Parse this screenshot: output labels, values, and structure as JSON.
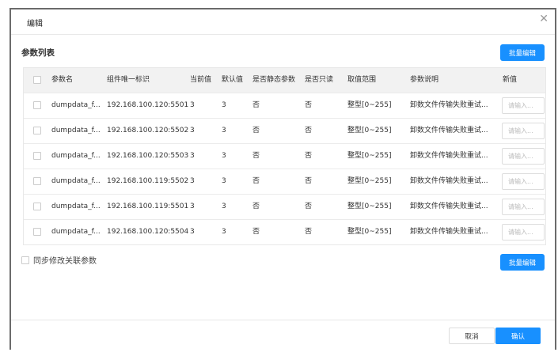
{
  "dialog": {
    "title": "编辑",
    "close_icon": "close-icon"
  },
  "section_title": "参数列表",
  "batch_edit_label": "批量编辑",
  "table": {
    "headers": [
      "参数名",
      "组件唯一标识",
      "当前值",
      "默认值",
      "是否静态参数",
      "是否只读",
      "取值范围",
      "参数说明",
      "新值"
    ],
    "rows": [
      {
        "name": "dumpdata_f...",
        "id": "192.168.100.120:5501",
        "current": "3",
        "default": "3",
        "static": "否",
        "readonly": "否",
        "range": "整型[0~255]",
        "desc": "卸数文件传输失败重试...",
        "placeholder": "请输入..."
      },
      {
        "name": "dumpdata_f...",
        "id": "192.168.100.120:5502",
        "current": "3",
        "default": "3",
        "static": "否",
        "readonly": "否",
        "range": "整型[0~255]",
        "desc": "卸数文件传输失败重试...",
        "placeholder": "请输入..."
      },
      {
        "name": "dumpdata_f...",
        "id": "192.168.100.120:5503",
        "current": "3",
        "default": "3",
        "static": "否",
        "readonly": "否",
        "range": "整型[0~255]",
        "desc": "卸数文件传输失败重试...",
        "placeholder": "请输入..."
      },
      {
        "name": "dumpdata_f...",
        "id": "192.168.100.119:5502",
        "current": "3",
        "default": "3",
        "static": "否",
        "readonly": "否",
        "range": "整型[0~255]",
        "desc": "卸数文件传输失败重试...",
        "placeholder": "请输入..."
      },
      {
        "name": "dumpdata_f...",
        "id": "192.168.100.119:5501",
        "current": "3",
        "default": "3",
        "static": "否",
        "readonly": "否",
        "range": "整型[0~255]",
        "desc": "卸数文件传输失败重试...",
        "placeholder": "请输入..."
      },
      {
        "name": "dumpdata_f...",
        "id": "192.168.100.120:5504",
        "current": "3",
        "default": "3",
        "static": "否",
        "readonly": "否",
        "range": "整型[0~255]",
        "desc": "卸数文件传输失败重试...",
        "placeholder": "请输入..."
      }
    ]
  },
  "sync_label": "同步修改关联参数",
  "footer": {
    "cancel": "取消",
    "confirm": "确认"
  },
  "colors": {
    "primary": "#1890ff"
  }
}
